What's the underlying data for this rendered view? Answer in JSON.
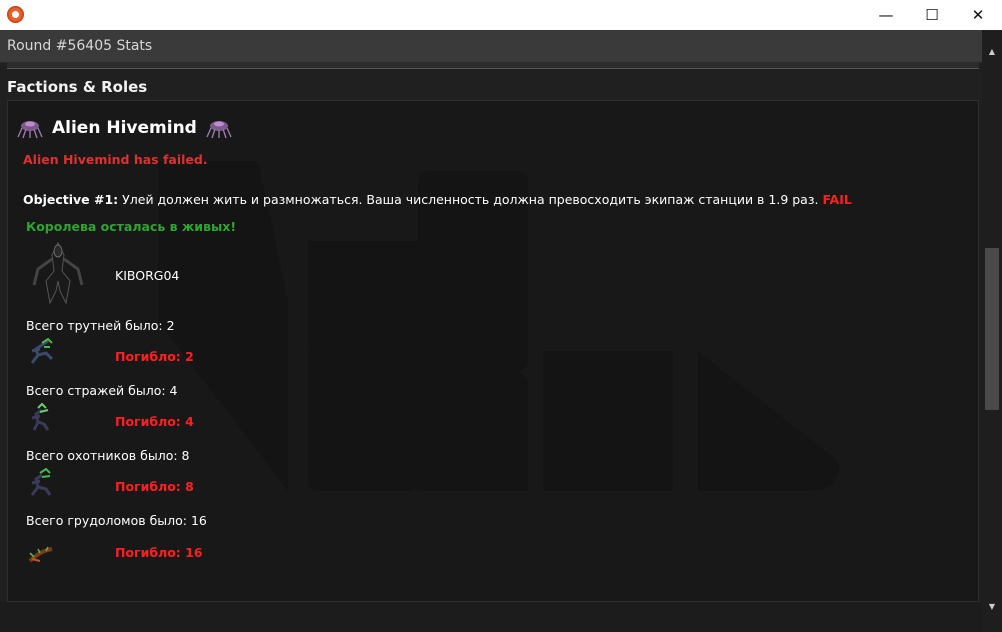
{
  "window": {
    "minimize_glyph": "—",
    "maximize_glyph": "☐",
    "close_glyph": "✕"
  },
  "header": {
    "title": "Round #56405 Stats"
  },
  "section": {
    "title": "Factions & Roles"
  },
  "faction": {
    "title": "Alien Hivemind",
    "icon": "xeno-hive-icon",
    "result": "Alien Hivemind has failed.",
    "objective_label": "Objective #1:",
    "objective_text": "Улей должен жить и размножаться. Ваша численность должна превосходить экипаж станции в 1.9 раз.",
    "objective_status": "FAIL",
    "queen_status": "Королева осталась в живых!",
    "queen_player": "KIBORG04",
    "castes": [
      {
        "count_text": "Всего трутней было: 2",
        "died_text": "Погибло: 2",
        "icon": "drone-icon"
      },
      {
        "count_text": "Всего стражей было: 4",
        "died_text": "Погибло: 4",
        "icon": "sentinel-icon"
      },
      {
        "count_text": "Всего охотников было: 8",
        "died_text": "Погибло: 8",
        "icon": "hunter-icon"
      },
      {
        "count_text": "Всего грудоломов было: 16",
        "died_text": "Погибло: 16",
        "icon": "larva-icon"
      }
    ]
  },
  "colors": {
    "fail_red": "#ff2020",
    "success_green": "#2ea52e",
    "panel_bg": "#181818"
  }
}
